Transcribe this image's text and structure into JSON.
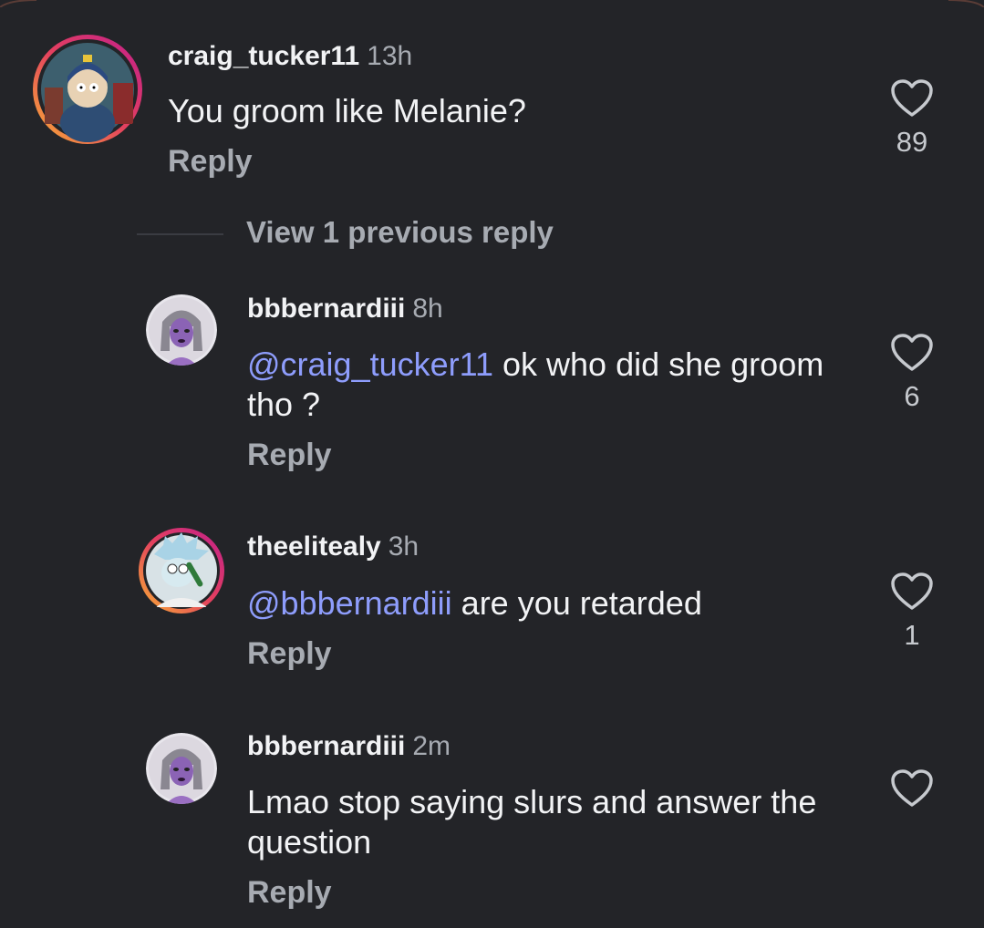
{
  "comments": [
    {
      "username": "craig_tucker11",
      "time": "13h",
      "mention": "",
      "text": "You groom like Melanie?",
      "reply": "Reply",
      "likes": "89",
      "avatar_ring": true
    },
    {
      "username": "bbbernardiii",
      "time": "8h",
      "mention": "@craig_tucker11",
      "text": " ok who did she groom tho ?",
      "reply": "Reply",
      "likes": "6",
      "avatar_ring": false
    },
    {
      "username": "theelitealy",
      "time": "3h",
      "mention": "@bbbernardiii",
      "text": " are you retarded",
      "reply": "Reply",
      "likes": "1",
      "avatar_ring": true
    },
    {
      "username": "bbbernardiii",
      "time": "2m",
      "mention": "",
      "text": "Lmao stop saying slurs and answer the question",
      "reply": "Reply",
      "likes": "",
      "avatar_ring": false
    }
  ],
  "view_previous": "View 1 previous reply",
  "colors": {
    "background": "#232428",
    "mention": "#8e9dfc",
    "secondary_text": "#a7abb2",
    "story_ring_start": "#f9b233",
    "story_ring_end": "#c21f8c"
  },
  "icons": {
    "like": "heart-outline-icon"
  }
}
